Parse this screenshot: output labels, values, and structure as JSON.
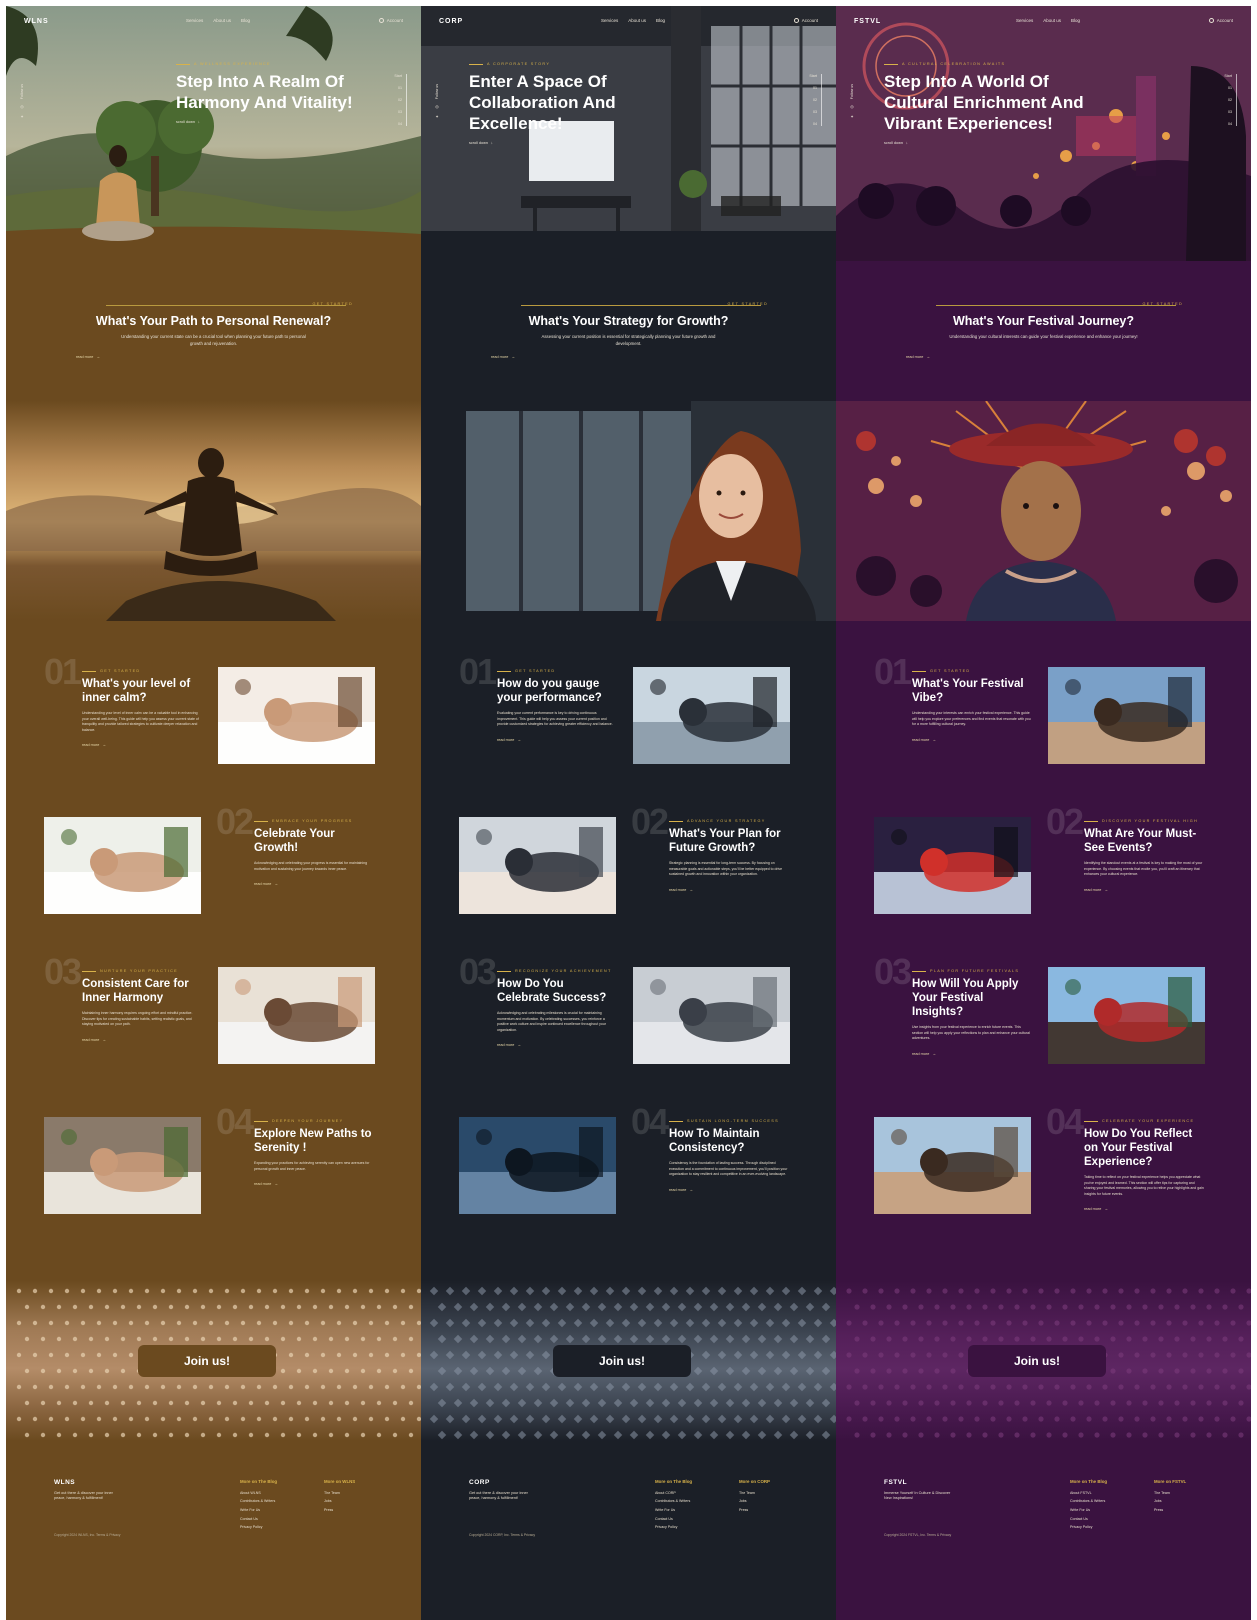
{
  "common": {
    "nav_links": [
      "Services",
      "About us",
      "Blog"
    ],
    "account_label": "Account",
    "scroll_label": "scroll down",
    "follow_label": "Follow us",
    "start_label": "Start",
    "step_labels": [
      "01",
      "02",
      "03",
      "04"
    ],
    "read_more": "read more",
    "get_started": "GET STARTED",
    "join_label": "Join us!",
    "footer_blog_heading": "More on The Blog",
    "footer_blog_links": [
      "About {brand}",
      "Contributors & Writers",
      "Write For Us",
      "Contact Us",
      "Privacy Policy"
    ],
    "footer_brand_links": [
      "The Team",
      "Jobs",
      "Press"
    ]
  },
  "columns": [
    {
      "brand": "WLNS",
      "theme": {
        "bg": "#6b4a1f",
        "accent": "#d8b24a"
      },
      "hero": {
        "eyebrow": "A WELLNESS EXPERIENCE",
        "title": "Step Into A Realm Of Harmony And Vitality!"
      },
      "strategy": {
        "title": "What's Your Path to Personal Renewal?",
        "subtitle": "Understanding your current state can be a crucial tool when planning your future path to personal growth and rejuvenation."
      },
      "features": [
        {
          "num": "01",
          "eyebrow": "GET STARTED",
          "title": "What's your level of inner calm?",
          "desc": "Understanding your level of inner calm can be a valuable tool in enhancing your overall well-being. This guide will help you assess your current state of tranquility and provide tailored strategies to cultivate deeper relaxation and balance."
        },
        {
          "num": "02",
          "eyebrow": "EMBRACE YOUR PROGRESS",
          "title": "Celebrate Your Growth!",
          "desc": "Acknowledging and celebrating your progress is essential for maintaining motivation and sustaining your journey towards inner peace."
        },
        {
          "num": "03",
          "eyebrow": "NURTURE YOUR PRACTICE",
          "title": "Consistent Care for Inner Harmony",
          "desc": "Maintaining inner harmony requires ongoing effort and mindful practice. Discover tips for creating sustainable habits, setting realistic goals, and staying motivated on your path."
        },
        {
          "num": "04",
          "eyebrow": "DEEPEN YOUR JOURNEY",
          "title": "Explore New Paths to Serenity !",
          "desc": "Expanding your practices for achieving serenity can open new avenues for personal growth and inner peace."
        }
      ],
      "footer": {
        "tagline": "Get out there & discover your inner peace, harmony & fulfillment!",
        "brand_heading": "More on WLNS",
        "copyright": "Copyright 2024 WLNS, Inc. Terms & Privacy"
      }
    },
    {
      "brand": "CORP",
      "theme": {
        "bg": "#1b1f27",
        "accent": "#d8b24a"
      },
      "hero": {
        "eyebrow": "A CORPORATE STORY",
        "title": "Enter A Space Of Collaboration And Excellence!"
      },
      "strategy": {
        "title": "What's Your Strategy for Growth?",
        "subtitle": "Assessing your current position is essential for strategically planning your future growth and development."
      },
      "features": [
        {
          "num": "01",
          "eyebrow": "GET STARTED",
          "title": "How do you gauge your performance?",
          "desc": "Evaluating your current performance is key to driving continuous improvement. This guide will help you assess your current position and provide customized strategies for achieving greater efficiency and balance."
        },
        {
          "num": "02",
          "eyebrow": "ADVANCE YOUR STRATEGY",
          "title": "What's Your Plan for Future Growth?",
          "desc": "Strategic planning is essential for long-term success. By focusing on measurable goals and actionable steps, you'll be better equipped to drive sustained growth and innovation within your organization."
        },
        {
          "num": "03",
          "eyebrow": "RECOGNIZE YOUR ACHIEVEMENT",
          "title": "How Do You Celebrate Success?",
          "desc": "Acknowledging and celebrating milestones is crucial for maintaining momentum and motivation. By celebrating successes, you reinforce a positive work culture and inspire continued excellence throughout your organization."
        },
        {
          "num": "04",
          "eyebrow": "SUSTAIN LONG-TERM SUCCESS",
          "title": "How To Maintain Consistency?",
          "desc": "Consistency is the foundation of lasting success. Through disciplined execution and a commitment to continuous improvement, you'll position your organization to stay resilient and competitive in an ever-evolving landscape."
        }
      ],
      "footer": {
        "tagline": "Get out there & discover your inner peace, harmony & fulfillment!",
        "brand_heading": "More on CORP",
        "copyright": "Copyright 2024 CORP, Inc. Terms & Privacy"
      }
    },
    {
      "brand": "FSTVL",
      "theme": {
        "bg": "#3a1240",
        "accent": "#d8b24a"
      },
      "hero": {
        "eyebrow": "A CULTURAL CELEBRATION AWAITS",
        "title": "Step Into A World Of Cultural Enrichment And Vibrant Experiences!"
      },
      "strategy": {
        "title": "What's Your Festival Journey?",
        "subtitle": "Understanding your cultural interests can guide your festival experience and enhance your journey!"
      },
      "features": [
        {
          "num": "01",
          "eyebrow": "GET STARTED",
          "title": "What's Your Festival Vibe?",
          "desc": "Understanding your interests can enrich your festival experience. This guide will help you explore your preferences and find events that resonate with you for a more fulfilling cultural journey."
        },
        {
          "num": "02",
          "eyebrow": "DISCOVER YOUR FESTIVAL HIGH",
          "title": "What Are Your Must-See Events?",
          "desc": "Identifying the standout events at a festival is key to making the most of your experience. By choosing events that excite you, you'll craft an itinerary that enhances your cultural experience."
        },
        {
          "num": "03",
          "eyebrow": "PLAN FOR FUTURE FESTIVALS",
          "title": "How Will You Apply Your Festival Insights?",
          "desc": "Use insights from your festival experience to enrich future events. This section will help you apply your reflections to plan and enhance your cultural adventures."
        },
        {
          "num": "04",
          "eyebrow": "CELEBRATE YOUR EXPERIENCE",
          "title": "How Do You Reflect on Your Festival Experience?",
          "desc": "Taking time to reflect on your festival experience helps you appreciate what you've enjoyed and learned. This section will offer tips for capturing and sharing your festival memories, allowing you to relive your highlights and gain insights for future events."
        }
      ],
      "footer": {
        "tagline": "Immerse Yourself In Culture & Discover New Inspirations!",
        "brand_heading": "More on FSTVL",
        "copyright": "Copyright 2024 FSTVL, Inc. Terms & Privacy"
      }
    }
  ]
}
